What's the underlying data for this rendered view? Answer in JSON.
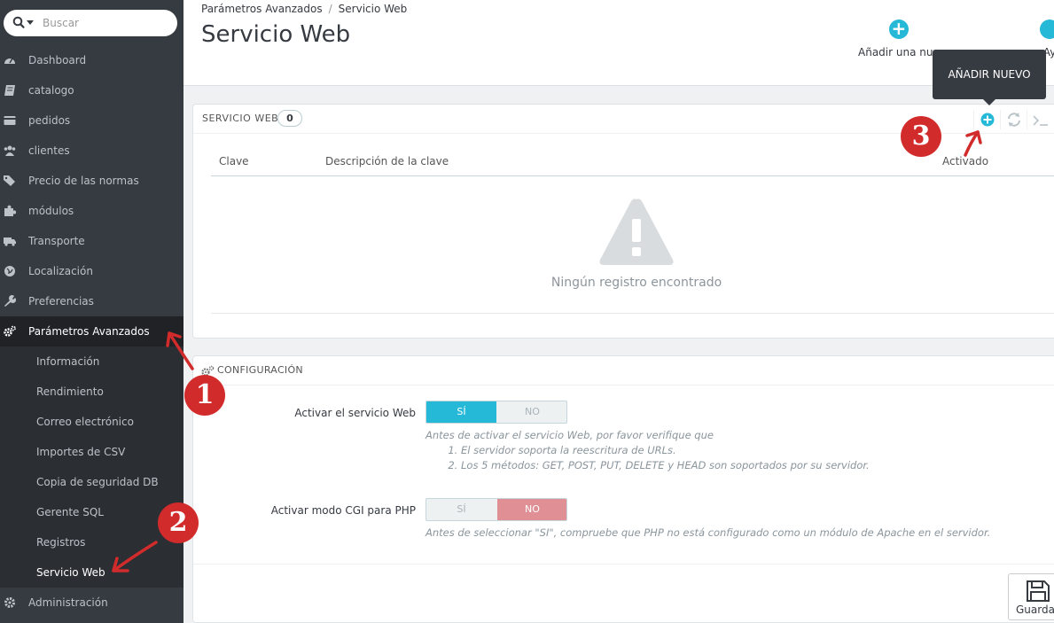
{
  "search": {
    "placeholder": "Buscar"
  },
  "sidebar": {
    "items": [
      {
        "label": "Dashboard",
        "icon": "dashboard-icon"
      },
      {
        "label": "catalogo",
        "icon": "book-icon"
      },
      {
        "label": "pedidos",
        "icon": "credit-card-icon"
      },
      {
        "label": "clientes",
        "icon": "users-icon"
      },
      {
        "label": "Precio de las normas",
        "icon": "tags-icon"
      },
      {
        "label": "módulos",
        "icon": "puzzle-icon"
      },
      {
        "label": "Transporte",
        "icon": "truck-icon"
      },
      {
        "label": "Localización",
        "icon": "globe-icon"
      },
      {
        "label": "Preferencias",
        "icon": "wrench-icon"
      },
      {
        "label": "Parámetros Avanzados",
        "icon": "cogs-icon"
      },
      {
        "label": "Administración",
        "icon": "gear-icon"
      }
    ],
    "subitems": [
      "Información",
      "Rendimiento",
      "Correo electrónico",
      "Importes de CSV",
      "Copia de seguridad DB",
      "Gerente SQL",
      "Registros",
      "Servicio Web"
    ]
  },
  "header": {
    "breadcrumb": [
      "Parámetros Avanzados",
      "Servicio Web"
    ],
    "separator": "/",
    "title": "Servicio Web",
    "toolbar_add_label": "Añadir una nue",
    "toolbar_help_label": "Ay"
  },
  "tooltip": "AÑADIR NUEVO",
  "list_panel": {
    "title": "SERVICIO WEB",
    "count": "0",
    "columns": [
      "Clave",
      "Descripción de la clave",
      "Activado"
    ],
    "empty_message": "Ningún registro encontrado"
  },
  "config_panel": {
    "title": "CONFIGURACIÓN",
    "fields": [
      {
        "label": "Activar el servicio Web",
        "options": [
          "SÍ",
          "NO"
        ],
        "selected": "SÍ",
        "help_intro": "Antes de activar el servicio Web, por favor verifique que",
        "help_list": [
          "El servidor soporta la reescritura de URLs.",
          "Los 5 métodos: GET, POST, PUT, DELETE y HEAD son soportados por su servidor."
        ]
      },
      {
        "label": "Activar modo CGI para PHP",
        "options": [
          "SÍ",
          "NO"
        ],
        "selected": "NO",
        "help_intro": "Antes de seleccionar \"SI\", compruebe que PHP no está configurado como un módulo de Apache en el servidor."
      }
    ],
    "save_label": "Guardar"
  },
  "annotations": [
    "1",
    "2",
    "3"
  ],
  "colors": {
    "accent": "#25b9d7",
    "sidebar": "#363a41",
    "no_active": "#e08f95",
    "annotation": "#d22b2b"
  }
}
